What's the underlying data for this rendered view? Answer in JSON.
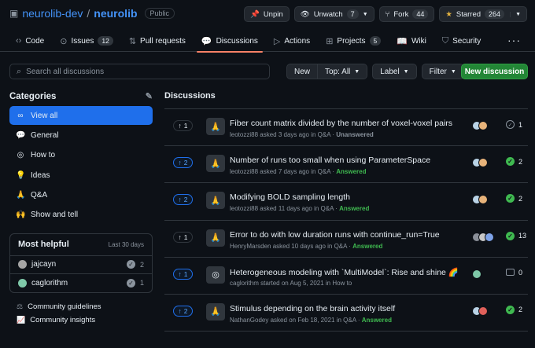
{
  "repo": {
    "owner": "neurolib-dev",
    "separator": "/",
    "name": "neurolib",
    "visibility": "Public",
    "icon": "repo-icon"
  },
  "actions": {
    "unpin": "Unpin",
    "unwatch": "Unwatch",
    "unwatch_count": "7",
    "fork": "Fork",
    "fork_count": "44",
    "starred": "Starred",
    "star_count": "264"
  },
  "tabs": [
    {
      "label": "Code",
      "icon": "code-icon"
    },
    {
      "label": "Issues",
      "count": "12",
      "icon": "issue-icon"
    },
    {
      "label": "Pull requests",
      "icon": "pull-request-icon"
    },
    {
      "label": "Discussions",
      "icon": "discussion-icon",
      "active": true
    },
    {
      "label": "Actions",
      "icon": "play-icon"
    },
    {
      "label": "Projects",
      "count": "5",
      "icon": "table-icon"
    },
    {
      "label": "Wiki",
      "icon": "book-icon"
    },
    {
      "label": "Security",
      "icon": "shield-icon"
    }
  ],
  "search": {
    "placeholder": "Search all discussions"
  },
  "toolbar": {
    "new": "New",
    "top": "Top: All",
    "label": "Label",
    "filter": "Filter",
    "new_discussion": "New discussion"
  },
  "categories": {
    "title": "Categories",
    "items": [
      {
        "label": "View all",
        "emoji": "∞",
        "active": true
      },
      {
        "label": "General",
        "emoji": "💬"
      },
      {
        "label": "How to",
        "emoji": "◎"
      },
      {
        "label": "Ideas",
        "emoji": "💡"
      },
      {
        "label": "Q&A",
        "emoji": "🙏"
      },
      {
        "label": "Show and tell",
        "emoji": "🙌"
      }
    ]
  },
  "most_helpful": {
    "title": "Most helpful",
    "period": "Last 30 days",
    "users": [
      {
        "name": "jajcayn",
        "count": "2",
        "color": "#a5a5a5"
      },
      {
        "name": "caglorithm",
        "count": "1",
        "color": "#7ec8a8"
      }
    ]
  },
  "footer": {
    "guidelines": "Community guidelines",
    "insights": "Community insights"
  },
  "discussions": {
    "title": "Discussions",
    "items": [
      {
        "votes": "1",
        "voted": false,
        "icon": "🙏",
        "title": "Fiber count matrix divided by the number of voxel-voxel pairs",
        "author": "leotozzi88",
        "verb": "asked",
        "when": "3 days ago",
        "category": "Q&A",
        "status": "Unanswered",
        "answered": false,
        "count": "1",
        "avatars": [
          "#b9d3e6",
          "#e7b37a"
        ]
      },
      {
        "votes": "2",
        "voted": true,
        "icon": "🙏",
        "title": "Number of runs too small when using ParameterSpace",
        "author": "leotozzi88",
        "verb": "asked",
        "when": "7 days ago",
        "category": "Q&A",
        "status": "Answered",
        "answered": true,
        "count": "2",
        "avatars": [
          "#b9d3e6",
          "#e7b37a"
        ]
      },
      {
        "votes": "2",
        "voted": true,
        "icon": "🙏",
        "title": "Modifying BOLD sampling length",
        "author": "leotozzi88",
        "verb": "asked",
        "when": "11 days ago",
        "category": "Q&A",
        "status": "Answered",
        "answered": true,
        "count": "2",
        "avatars": [
          "#b9d3e6",
          "#e7b37a"
        ]
      },
      {
        "votes": "1",
        "voted": false,
        "icon": "🙏",
        "title": "Error to do with low duration runs with continue_run=True",
        "author": "HenryMarsden",
        "verb": "asked",
        "when": "10 days ago",
        "category": "Q&A",
        "status": "Answered",
        "answered": true,
        "count": "13",
        "avatars": [
          "#8a8f98",
          "#c7c7c7",
          "#7ea3e8"
        ]
      },
      {
        "votes": "1",
        "voted": true,
        "icon": "◎",
        "title": "Heterogeneous modeling with `MultiModel`: Rise and shine 🌈",
        "author": "caglorithm",
        "verb": "started",
        "when": "on Aug 5, 2021",
        "category": "How to",
        "status": "",
        "answered": false,
        "count": "0",
        "avatars": [
          "#7ec8a8"
        ]
      },
      {
        "votes": "2",
        "voted": true,
        "icon": "🙏",
        "title": "Stimulus depending on the brain activity itself",
        "author": "NathanGodey",
        "verb": "asked",
        "when": "on Feb 18, 2021",
        "category": "Q&A",
        "status": "Answered",
        "answered": true,
        "count": "2",
        "avatars": [
          "#b9d3e6",
          "#e0605a"
        ]
      }
    ]
  },
  "colors": {
    "accent": "#1f6feb",
    "success": "#238636",
    "answered": "#3fb950",
    "active_tab": "#f78166"
  }
}
